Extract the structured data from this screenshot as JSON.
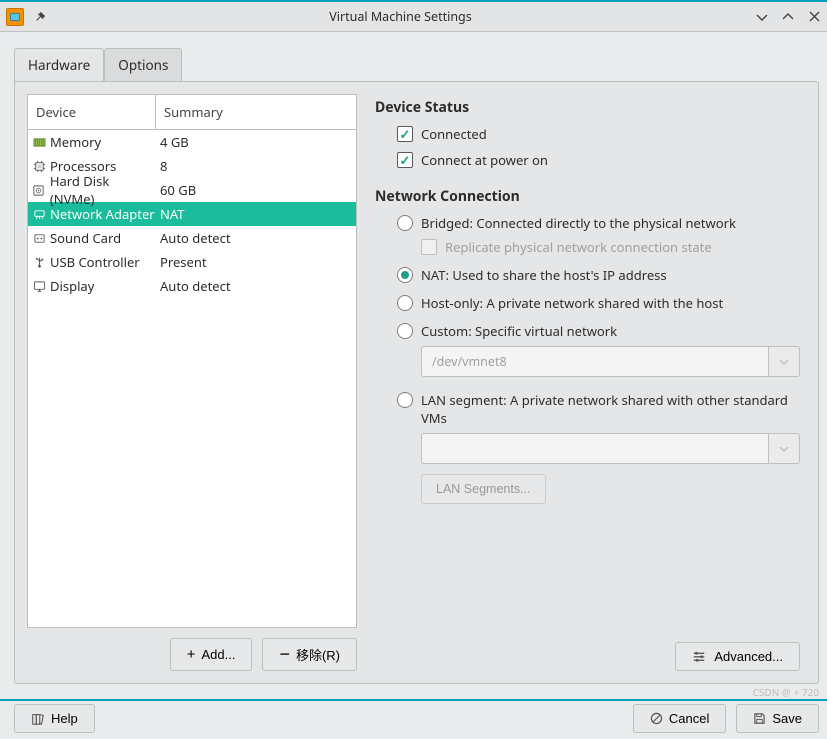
{
  "window": {
    "title": "Virtual Machine Settings"
  },
  "tabs": {
    "hardware": "Hardware",
    "options": "Options"
  },
  "table": {
    "headers": {
      "device": "Device",
      "summary": "Summary"
    },
    "rows": [
      {
        "icon": "memory",
        "device": "Memory",
        "summary": "4 GB",
        "selected": false
      },
      {
        "icon": "cpu",
        "device": "Processors",
        "summary": "8",
        "selected": false
      },
      {
        "icon": "disk",
        "device": "Hard Disk (NVMe)",
        "summary": "60 GB",
        "selected": false
      },
      {
        "icon": "net",
        "device": "Network Adapter",
        "summary": "NAT",
        "selected": true
      },
      {
        "icon": "sound",
        "device": "Sound Card",
        "summary": "Auto detect",
        "selected": false
      },
      {
        "icon": "usb",
        "device": "USB Controller",
        "summary": "Present",
        "selected": false
      },
      {
        "icon": "display",
        "device": "Display",
        "summary": "Auto detect",
        "selected": false
      }
    ]
  },
  "buttons": {
    "add": "Add...",
    "remove": "移除(R)",
    "advanced": "Advanced...",
    "help": "Help",
    "cancel": "Cancel",
    "save": "Save",
    "lan_segments": "LAN Segments..."
  },
  "device_status": {
    "title": "Device Status",
    "connected": "Connected",
    "connect_power": "Connect at power on"
  },
  "network": {
    "title": "Network Connection",
    "bridged": "Bridged: Connected directly to the physical network",
    "replicate": "Replicate physical network connection state",
    "nat": "NAT: Used to share the host's IP address",
    "hostonly": "Host-only: A private network shared with the host",
    "custom": "Custom: Specific virtual network",
    "custom_value": "/dev/vmnet8",
    "lan": "LAN segment: A private network shared with other standard VMs"
  },
  "watermark": "CSDN @ + 720"
}
